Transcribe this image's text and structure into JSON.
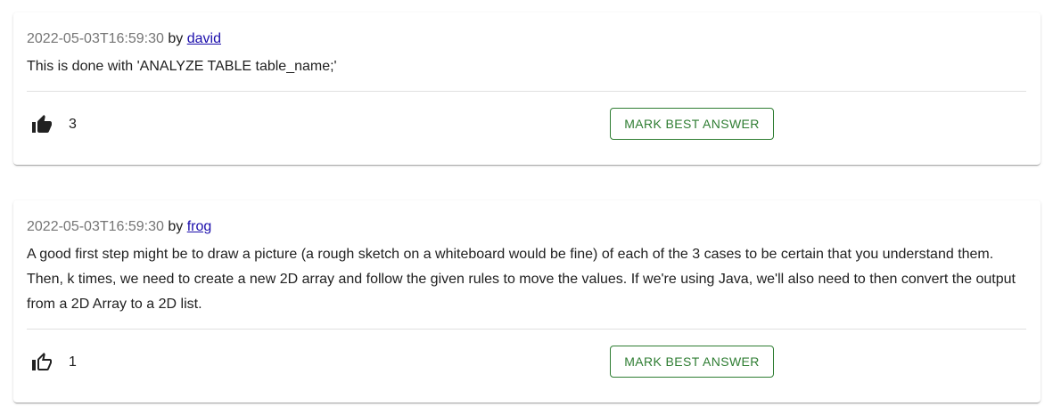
{
  "answers": [
    {
      "date": "2022-05-03T16:59:30",
      "by_label": "by",
      "author": "david",
      "body": "This is done with 'ANALYZE TABLE table_name;'",
      "votes": "3",
      "vote_icon": "thumb-up-filled-icon",
      "best_answer_label": "MARK BEST ANSWER"
    },
    {
      "date": "2022-05-03T16:59:30",
      "by_label": "by",
      "author": "frog",
      "body": "A good first step might be to draw a picture (a rough sketch on a whiteboard would be fine) of each of the 3 cases to be certain that you understand them. Then, k times, we need to create a new 2D array and follow the given rules to move the values. If we're using Java, we'll also need to then convert the output from a 2D Array to a 2D list.",
      "votes": "1",
      "vote_icon": "thumb-up-outline-icon",
      "best_answer_label": "MARK BEST ANSWER"
    }
  ],
  "colors": {
    "accent_green": "#2e7d32",
    "link_blue": "#1a0dab",
    "date_gray": "#757575"
  }
}
